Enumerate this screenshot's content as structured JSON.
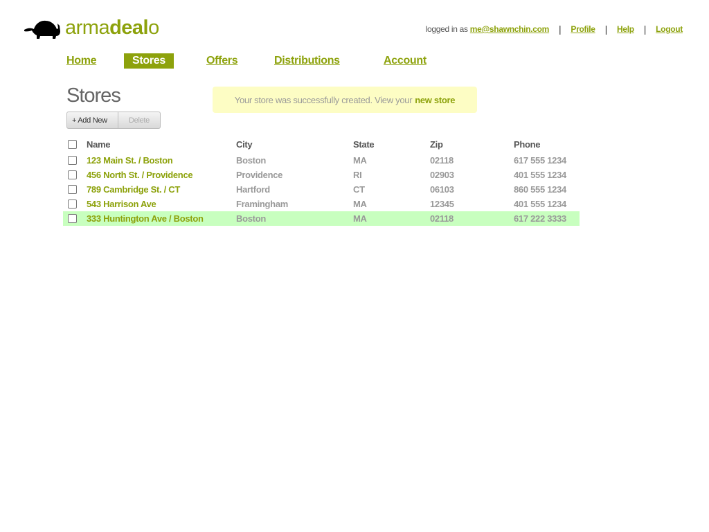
{
  "brand": {
    "name_light": "arma",
    "name_bold": "deal",
    "name_end": "o"
  },
  "user": {
    "logged_in_label": "logged in as",
    "email": "me@shawnchin.com",
    "separator": "|",
    "links": [
      "Profile",
      "Help",
      "Logout"
    ]
  },
  "nav": {
    "items": [
      "Home",
      "Stores",
      "Offers",
      "Distributions",
      "Account"
    ],
    "active": "Stores"
  },
  "page": {
    "title": "Stores"
  },
  "flash": {
    "message": "Your store was successfully created. View your",
    "link": "new store"
  },
  "toolbar": {
    "add_label": "+ Add New",
    "delete_label": "Delete"
  },
  "table": {
    "columns": [
      "Name",
      "City",
      "State",
      "Zip",
      "Phone"
    ],
    "rows": [
      [
        "123 Main St. / Boston",
        "Boston",
        "MA",
        "02118",
        "617 555 1234"
      ],
      [
        "456 North St. / Providence",
        "Providence",
        "RI",
        "02903",
        "401 555 1234"
      ],
      [
        "789 Cambridge St. / CT",
        "Hartford",
        "CT",
        "06103",
        "860 555 1234"
      ],
      [
        "543 Harrison Ave",
        "Framingham",
        "MA",
        "12345",
        "401 555 1234"
      ],
      [
        "333 Huntington Ave / Boston",
        "Boston",
        "MA",
        "02118",
        "617 222 3333"
      ]
    ],
    "highlighted_row": 4
  },
  "colors": {
    "accent": "#8da20c",
    "flash_bg": "#fdfdc4",
    "highlight_row": "#c8ffbf"
  }
}
